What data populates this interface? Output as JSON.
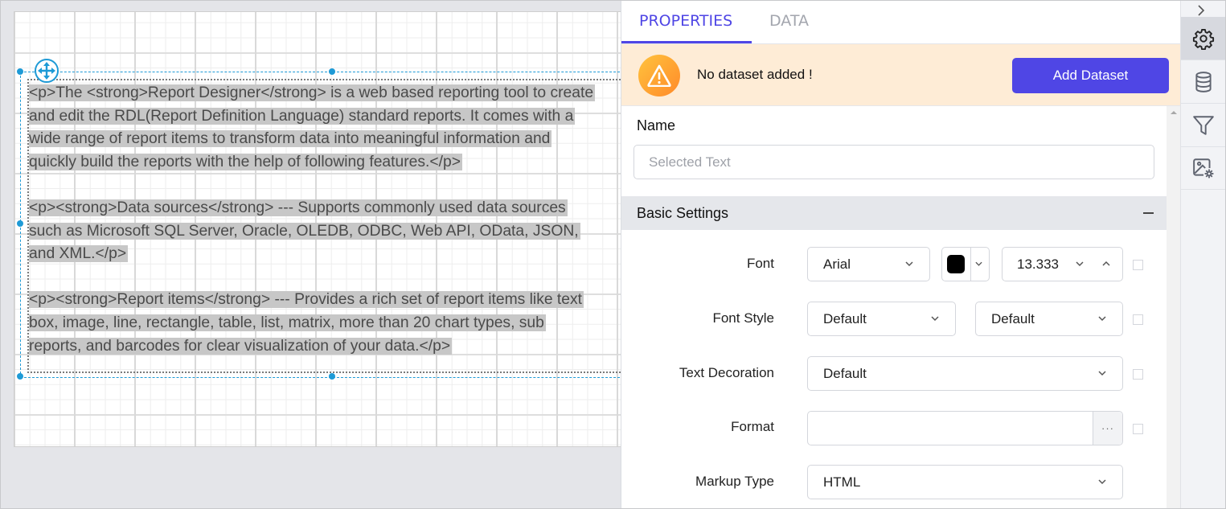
{
  "canvas": {
    "paragraphs": [
      [
        "<p>The <strong>Report Designer</strong> is a web based reporting tool to create",
        "and edit the RDL(Report Definition Language) standard reports. It comes with a",
        "wide range of report items to transform data into meaningful information and",
        "quickly build the reports with the help of following features.</p>"
      ],
      [
        "<p><strong>Data sources</strong> --- Supports commonly used data sources",
        "such as Microsoft SQL Server, Oracle, OLEDB, ODBC, Web API, OData, JSON,",
        "and XML.</p>"
      ],
      [
        "<p><strong>Report items</strong> --- Provides a rich set of report items like text",
        "box, image, line, rectangle, table, list, matrix, more than 20 chart types, sub",
        "reports, and barcodes for clear visualization of your data.</p>"
      ]
    ]
  },
  "panel": {
    "tabs": [
      {
        "label": "PROPERTIES",
        "active": true
      },
      {
        "label": "DATA",
        "active": false
      }
    ],
    "alert": {
      "icon": "warning-icon",
      "message": "No dataset added !",
      "button_label": "Add Dataset"
    },
    "name": {
      "label": "Name",
      "value": "",
      "placeholder": "Selected Text"
    },
    "section": {
      "title": "Basic Settings",
      "collapse_icon": "minus-icon"
    },
    "fields": {
      "font": {
        "label": "Font",
        "family": "Arial",
        "color": "#000000",
        "size": "13.333"
      },
      "font_style": {
        "label": "Font Style",
        "style": "Default",
        "weight": "Default"
      },
      "text_decoration": {
        "label": "Text Decoration",
        "value": "Default"
      },
      "format": {
        "label": "Format",
        "value": "",
        "button": "···"
      },
      "markup_type": {
        "label": "Markup Type",
        "value": "HTML"
      }
    }
  },
  "toolbar": {
    "items": [
      {
        "name": "properties",
        "icon": "gear-icon",
        "active": true
      },
      {
        "name": "data",
        "icon": "database-icon",
        "active": false
      },
      {
        "name": "filter",
        "icon": "filter-icon",
        "active": false
      },
      {
        "name": "image-settings",
        "icon": "image-settings-icon",
        "active": false
      }
    ],
    "collapse_icon": "chevron-right-icon"
  },
  "colors": {
    "accent": "#4f46e5",
    "selection": "#1e9ad6",
    "alert_bg": "#feecd6",
    "text_highlight": "#c7c7c7"
  }
}
